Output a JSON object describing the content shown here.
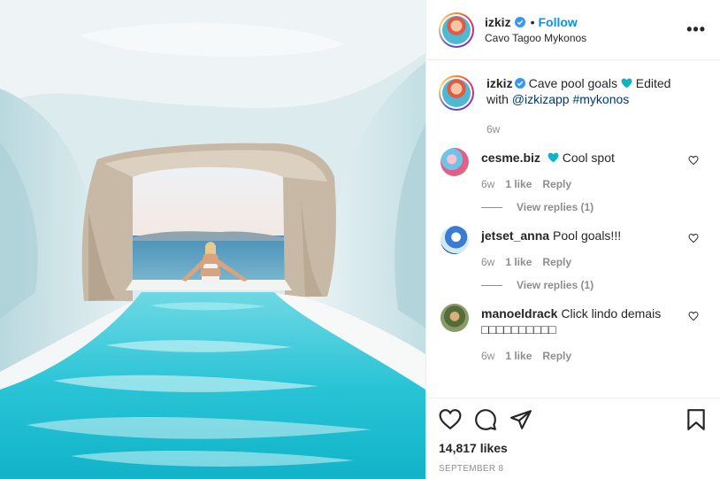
{
  "post": {
    "username": "izkiz",
    "follow_label": "Follow",
    "location": "Cavo Tagoo Mykonos",
    "more_label": "•••"
  },
  "caption": {
    "username": "izkiz",
    "text_before": "Cave pool goals",
    "edited_with": "Edited with",
    "mention": "@izkizapp",
    "hashtag": "#mykonos",
    "time": "6w"
  },
  "comments": [
    {
      "username": "cesme.biz",
      "text": "Cool spot",
      "time": "6w",
      "likes": "1 like",
      "reply_label": "Reply",
      "view_replies": "View replies (1)"
    },
    {
      "username": "jetset_anna",
      "text": "Pool goals!!!",
      "time": "6w",
      "likes": "1 like",
      "reply_label": "Reply",
      "view_replies": "View replies (1)"
    },
    {
      "username": "manoeldrack",
      "text": "Click lindo demais",
      "text2": "□□□□□□□□□□",
      "time": "6w",
      "likes": "1 like",
      "reply_label": "Reply"
    }
  ],
  "footer": {
    "likes": "14,817 likes",
    "date": "SEPTEMBER 8"
  },
  "colors": {
    "accent": "#0095f6",
    "verified": "#3897f0",
    "heart_teal": "#0fb4c4",
    "text": "#262626",
    "muted": "#8e8e8e"
  },
  "icons": [
    "verified-icon",
    "heart-icon",
    "comment-icon",
    "share-icon",
    "bookmark-icon",
    "more-icon"
  ]
}
